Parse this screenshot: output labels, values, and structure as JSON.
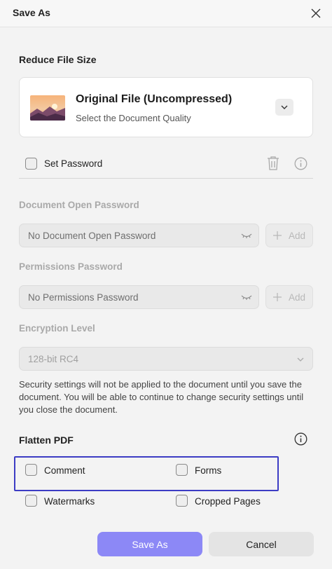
{
  "dialog": {
    "title": "Save As"
  },
  "reduce": {
    "heading": "Reduce File Size",
    "option_title": "Original File (Uncompressed)",
    "option_subtitle": "Select the Document Quality"
  },
  "password": {
    "set_label": "Set Password",
    "open_heading": "Document Open Password",
    "open_placeholder": "No Document Open Password",
    "perm_heading": "Permissions Password",
    "perm_placeholder": "No Permissions Password",
    "add_label": "Add",
    "encryption_heading": "Encryption Level",
    "encryption_value": "128-bit RC4",
    "note": "Security settings will not be applied to the document until you save the document. You will be able to continue to change security settings until you close the document."
  },
  "flatten": {
    "heading": "Flatten PDF",
    "options": [
      "Comment",
      "Forms",
      "Watermarks",
      "Cropped Pages"
    ]
  },
  "footer": {
    "save": "Save As",
    "cancel": "Cancel"
  },
  "colors": {
    "accent": "#8c88f6",
    "highlight": "#3c3cc4"
  }
}
